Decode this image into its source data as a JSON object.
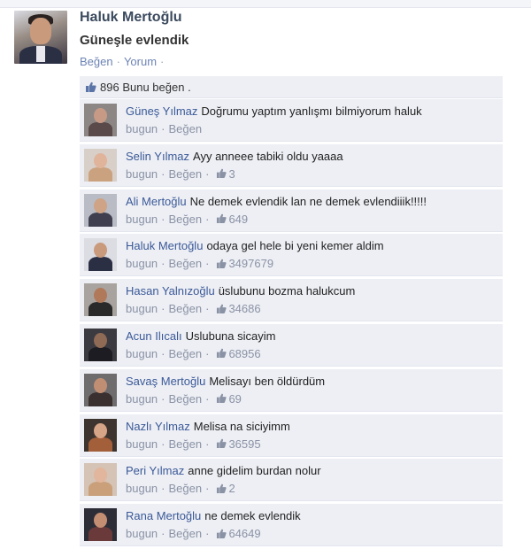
{
  "post": {
    "author": "Haluk Mertoğlu",
    "text": "Güneşle evlendik",
    "actions": [
      "Beğen",
      "Yorum"
    ],
    "likes_count": "896",
    "likes_text": "Bunu beğen ."
  },
  "comments": [
    {
      "name": "Güneş Yılmaz",
      "text": "Doğrumu yaptım yanlışmı bilmiyorum haluk",
      "time": "bugun",
      "like_label": "Beğen",
      "likes": ""
    },
    {
      "name": "Selin Yılmaz",
      "text": "Ayy anneee tabiki oldu yaaaa",
      "time": "bugun",
      "like_label": "Beğen",
      "likes": "3"
    },
    {
      "name": "Ali Mertoğlu",
      "text": "Ne demek evlendik lan ne demek evlendiiik!!!!!",
      "time": "bugun",
      "like_label": "Beğen",
      "likes": "649"
    },
    {
      "name": "Haluk Mertoğlu",
      "text": "odaya gel hele bi yeni kemer aldim",
      "time": "bugun",
      "like_label": "Beğen",
      "likes": "3497679"
    },
    {
      "name": "Hasan Yalnızoğlu",
      "text": "üslubunu bozma halukcum",
      "time": "bugun",
      "like_label": "Beğen",
      "likes": "34686"
    },
    {
      "name": "Acun Ilıcalı",
      "text": "Uslubuna sicayim",
      "time": "bugun",
      "like_label": "Beğen",
      "likes": "68956"
    },
    {
      "name": "Savaş Mertoğlu",
      "text": "Melisayı ben öldürdüm",
      "time": "bugun",
      "like_label": "Beğen",
      "likes": "69"
    },
    {
      "name": "Nazlı Yılmaz",
      "text": "Melisa na siciyimm",
      "time": "bugun",
      "like_label": "Beğen",
      "likes": "36595"
    },
    {
      "name": "Peri Yılmaz",
      "text": "anne gidelim burdan nolur",
      "time": "bugun",
      "like_label": "Beğen",
      "likes": "2"
    },
    {
      "name": "Rana Mertoğlu",
      "text": "ne demek evlendik",
      "time": "bugun",
      "like_label": "Beğen",
      "likes": "64649"
    }
  ],
  "colors": {
    "link": "#3b5998",
    "comment_bg": "#edeff4",
    "meta": "#8a92a5"
  },
  "icons": {
    "like": "thumbs-up-icon"
  }
}
